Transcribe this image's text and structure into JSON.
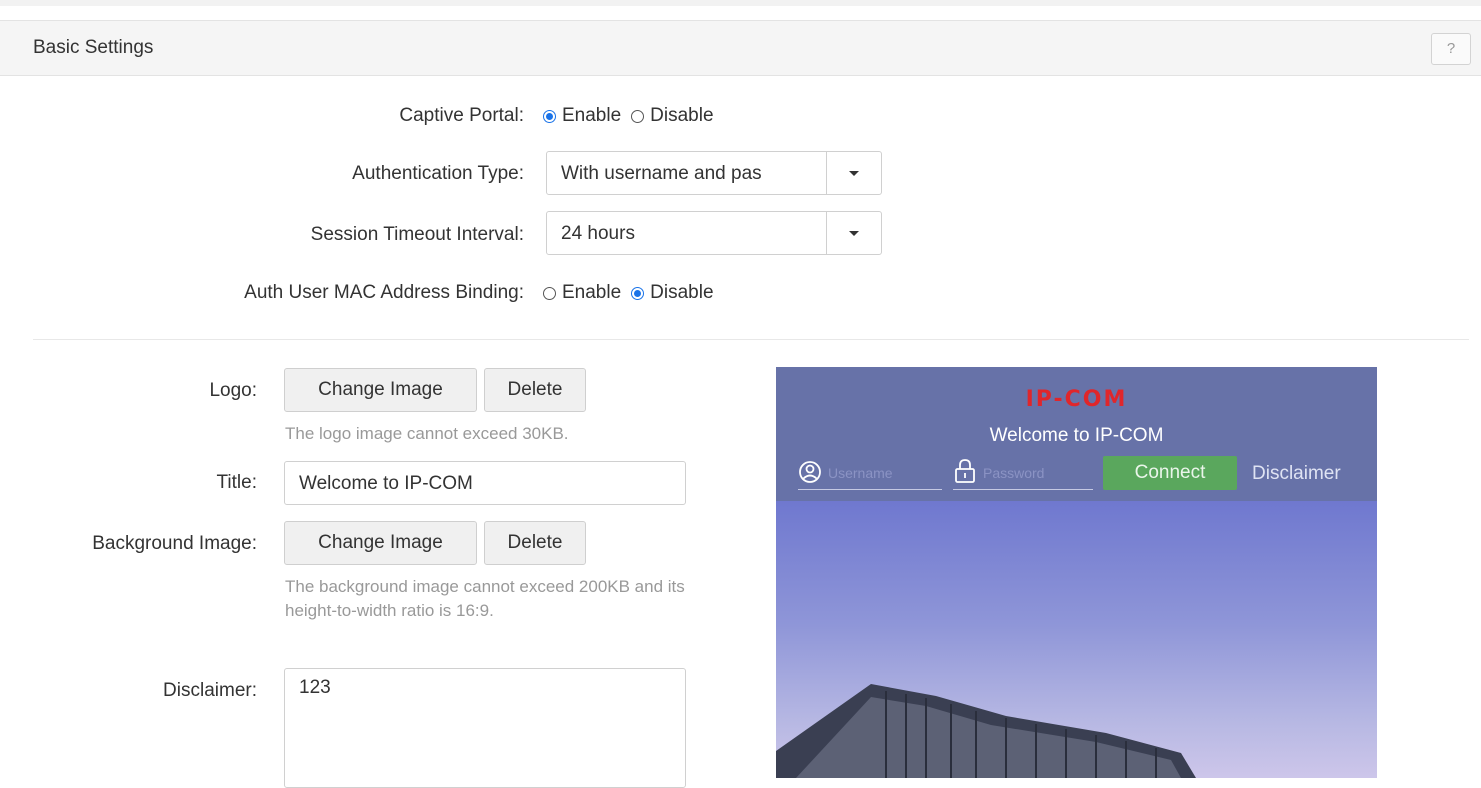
{
  "panel": {
    "title": "Basic Settings",
    "help_label": "?"
  },
  "captive_portal": {
    "label": "Captive Portal:",
    "options": [
      "Enable",
      "Disable"
    ],
    "selected": "Enable"
  },
  "auth_type": {
    "label": "Authentication Type:",
    "value": "With username and pas"
  },
  "session_timeout": {
    "label": "Session Timeout Interval:",
    "value": "24 hours"
  },
  "mac_binding": {
    "label": "Auth User MAC Address Binding:",
    "options": [
      "Enable",
      "Disable"
    ],
    "selected": "Disable"
  },
  "logo": {
    "label": "Logo:",
    "change_label": "Change Image",
    "delete_label": "Delete",
    "hint": "The logo image cannot exceed 30KB."
  },
  "title_field": {
    "label": "Title:",
    "value": "Welcome to IP-COM"
  },
  "background": {
    "label": "Background Image:",
    "change_label": "Change Image",
    "delete_label": "Delete",
    "hint": "The background image cannot exceed 200KB and its height-to-width ratio is 16:9."
  },
  "disclaimer": {
    "label": "Disclaimer:",
    "value": "123"
  },
  "preview": {
    "logo_text": "IP-COM",
    "welcome": "Welcome to IP-COM",
    "username_placeholder": "Username",
    "password_placeholder": "Password",
    "connect_label": "Connect",
    "disclaimer_label": "Disclaimer",
    "colors": {
      "header": "#6772a8",
      "connect": "#5aa75d",
      "logo": "#e0262b"
    },
    "icons": {
      "user": "user-icon",
      "lock": "lock-icon"
    }
  },
  "colors": {
    "accent": "#1a73e8"
  }
}
